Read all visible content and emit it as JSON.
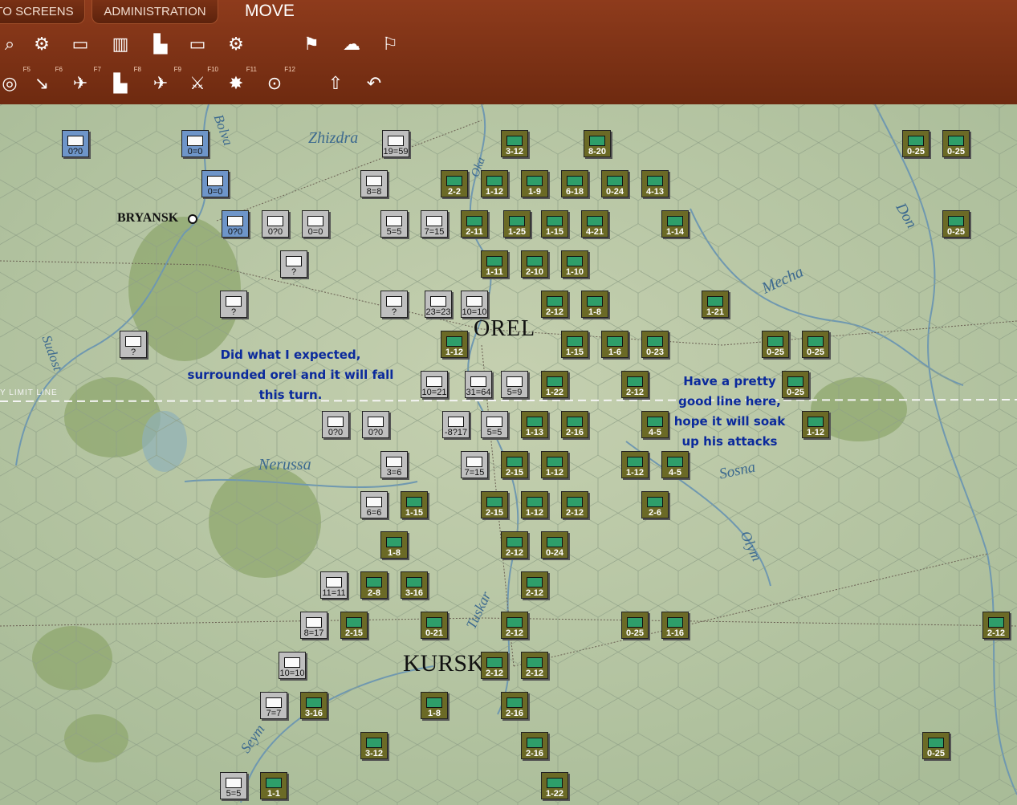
{
  "tabs": [
    "TO SCREENS",
    "ADMINISTRATION"
  ],
  "mode": "MOVE",
  "toolbar_row1": [
    "zoom-icon",
    "gear-icon",
    "window-icon",
    "chart-icon",
    "factory-icon",
    "rectangle-icon",
    "settings-alt-icon",
    "flag-report-icon",
    "weather-icon",
    "flag-icon"
  ],
  "toolbar_row2": [
    {
      "icon": "radar-icon",
      "fkey": "F5"
    },
    {
      "icon": "paradrop-icon",
      "fkey": "F6"
    },
    {
      "icon": "aircraft-icon",
      "fkey": "F7"
    },
    {
      "icon": "city-bomb-icon",
      "fkey": "F8"
    },
    {
      "icon": "airfield-icon",
      "fkey": "F9"
    },
    {
      "icon": "crossed-swords-icon",
      "fkey": "F10"
    },
    {
      "icon": "explosion-icon",
      "fkey": "F11"
    },
    {
      "icon": "target-icon",
      "fkey": "F12"
    },
    {
      "icon": "upload-icon",
      "fkey": ""
    },
    {
      "icon": "undo-icon",
      "fkey": ""
    }
  ],
  "cities": [
    {
      "name": "BRYANSK",
      "key": "bryansk"
    },
    {
      "name": "OREL",
      "key": "orel"
    },
    {
      "name": "KURSK",
      "key": "kursk"
    }
  ],
  "rivers": [
    "Zhizdra",
    "Bolva",
    "Oka",
    "Don",
    "Mecha",
    "Sudost",
    "Nerussa",
    "Sosna",
    "Olym",
    "Tuskar",
    "Seym"
  ],
  "limit_line_label": "Y LIMIT LINE",
  "notes": {
    "left": [
      "Did what I expected,",
      "surrounded orel and it will fall",
      "this turn."
    ],
    "right": [
      "Have a pretty",
      "good line here,",
      "hope it will soak",
      "up his attacks"
    ]
  },
  "units": [
    {
      "s": "0?0",
      "t": "sov-blue"
    },
    {
      "s": "0=0",
      "t": "sov-blue"
    },
    {
      "s": "0=0",
      "t": "sov-blue"
    },
    {
      "s": "0?0",
      "t": "sov-blue"
    },
    {
      "s": "0?0",
      "t": "sov"
    },
    {
      "s": "0=0",
      "t": "sov"
    },
    {
      "s": "?",
      "t": "sov"
    },
    {
      "s": "?",
      "t": "sov"
    },
    {
      "s": "?",
      "t": "sov"
    },
    {
      "s": "19=59",
      "t": "sov"
    },
    {
      "s": "8=8",
      "t": "sov"
    },
    {
      "s": "5=5",
      "t": "sov"
    },
    {
      "s": "7=15",
      "t": "sov"
    },
    {
      "s": "?",
      "t": "sov"
    },
    {
      "s": "23=23",
      "t": "sov"
    },
    {
      "s": "10=10",
      "t": "sov"
    },
    {
      "s": "10=21",
      "t": "sov"
    },
    {
      "s": "31=64",
      "t": "sov"
    },
    {
      "s": "5=9",
      "t": "sov"
    },
    {
      "s": "0?0",
      "t": "sov"
    },
    {
      "s": "0?0",
      "t": "sov"
    },
    {
      "s": "-8?17",
      "t": "sov"
    },
    {
      "s": "5=5",
      "t": "sov"
    },
    {
      "s": "3=6",
      "t": "sov"
    },
    {
      "s": "7=15",
      "t": "sov"
    },
    {
      "s": "6=6",
      "t": "sov"
    },
    {
      "s": "11=11",
      "t": "sov"
    },
    {
      "s": "8=17",
      "t": "sov"
    },
    {
      "s": "10=10",
      "t": "sov"
    },
    {
      "s": "7=7",
      "t": "sov"
    },
    {
      "s": "5=5",
      "t": "sov"
    },
    {
      "s": "3-12",
      "t": "axis"
    },
    {
      "s": "8-20",
      "t": "axis"
    },
    {
      "s": "2-2",
      "t": "axis"
    },
    {
      "s": "1-12",
      "t": "axis"
    },
    {
      "s": "1-9",
      "t": "axis"
    },
    {
      "s": "6-18",
      "t": "axis"
    },
    {
      "s": "0-24",
      "t": "axis"
    },
    {
      "s": "4-13",
      "t": "axis"
    },
    {
      "s": "2-11",
      "t": "axis"
    },
    {
      "s": "1-25",
      "t": "axis"
    },
    {
      "s": "1-15",
      "t": "axis"
    },
    {
      "s": "4-21",
      "t": "axis"
    },
    {
      "s": "1-14",
      "t": "axis"
    },
    {
      "s": "1-11",
      "t": "axis"
    },
    {
      "s": "2-10",
      "t": "axis"
    },
    {
      "s": "1-10",
      "t": "axis"
    },
    {
      "s": "2-12",
      "t": "axis"
    },
    {
      "s": "1-8",
      "t": "axis"
    },
    {
      "s": "1-21",
      "t": "axis"
    },
    {
      "s": "1-12",
      "t": "axis"
    },
    {
      "s": "1-15",
      "t": "axis"
    },
    {
      "s": "1-6",
      "t": "axis"
    },
    {
      "s": "0-23",
      "t": "axis"
    },
    {
      "s": "0-25",
      "t": "axis"
    },
    {
      "s": "0-25",
      "t": "axis"
    },
    {
      "s": "1-22",
      "t": "axis"
    },
    {
      "s": "2-12",
      "t": "axis"
    },
    {
      "s": "0-25",
      "t": "axis"
    },
    {
      "s": "1-13",
      "t": "axis"
    },
    {
      "s": "2-16",
      "t": "axis"
    },
    {
      "s": "4-5",
      "t": "axis"
    },
    {
      "s": "1-12",
      "t": "axis"
    },
    {
      "s": "2-15",
      "t": "axis"
    },
    {
      "s": "1-12",
      "t": "axis"
    },
    {
      "s": "1-12",
      "t": "axis"
    },
    {
      "s": "4-5",
      "t": "axis"
    },
    {
      "s": "1-15",
      "t": "axis"
    },
    {
      "s": "2-15",
      "t": "axis"
    },
    {
      "s": "1-12",
      "t": "axis"
    },
    {
      "s": "2-12",
      "t": "axis"
    },
    {
      "s": "2-6",
      "t": "axis"
    },
    {
      "s": "1-8",
      "t": "axis"
    },
    {
      "s": "2-12",
      "t": "axis"
    },
    {
      "s": "0-24",
      "t": "axis"
    },
    {
      "s": "2-8",
      "t": "axis"
    },
    {
      "s": "3-16",
      "t": "axis"
    },
    {
      "s": "2-12",
      "t": "axis"
    },
    {
      "s": "2-15",
      "t": "axis"
    },
    {
      "s": "0-21",
      "t": "axis"
    },
    {
      "s": "2-12",
      "t": "axis"
    },
    {
      "s": "0-25",
      "t": "axis"
    },
    {
      "s": "1-16",
      "t": "axis"
    },
    {
      "s": "2-12",
      "t": "axis"
    },
    {
      "s": "2-12",
      "t": "axis"
    },
    {
      "s": "3-16",
      "t": "axis"
    },
    {
      "s": "1-8",
      "t": "axis"
    },
    {
      "s": "2-16",
      "t": "axis"
    },
    {
      "s": "3-12",
      "t": "axis"
    },
    {
      "s": "2-16",
      "t": "axis"
    },
    {
      "s": "1-1",
      "t": "axis"
    },
    {
      "s": "1-22",
      "t": "axis"
    },
    {
      "s": "0-25",
      "t": "axis"
    },
    {
      "s": "0-25",
      "t": "axis"
    },
    {
      "s": "0-25",
      "t": "axis"
    },
    {
      "s": "0-25",
      "t": "axis"
    },
    {
      "s": "2-12",
      "t": "axis"
    }
  ]
}
